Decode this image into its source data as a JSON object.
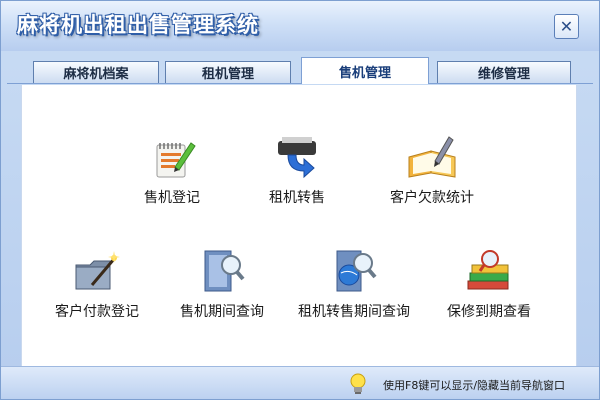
{
  "window": {
    "title": "麻将机出租出售管理系统",
    "close_glyph": "✕"
  },
  "tabs": [
    {
      "label": "麻将机档案",
      "active": false
    },
    {
      "label": "租机管理",
      "active": false
    },
    {
      "label": "售机管理",
      "active": true
    },
    {
      "label": "维修管理",
      "active": false
    }
  ],
  "items": [
    {
      "label": "售机登记",
      "icon": "notebook-pen-icon"
    },
    {
      "label": "租机转售",
      "icon": "printer-arrow-icon"
    },
    {
      "label": "客户欠款统计",
      "icon": "open-notebook-pencil-icon"
    },
    {
      "label": "客户付款登记",
      "icon": "folder-wand-icon"
    },
    {
      "label": "售机期间查询",
      "icon": "document-magnifier-icon"
    },
    {
      "label": "租机转售期间查询",
      "icon": "document-globe-magnifier-icon"
    },
    {
      "label": "保修到期查看",
      "icon": "books-magnifier-icon"
    }
  ],
  "status": {
    "text": "使用F8键可以显示/隐藏当前导航窗口",
    "icon": "lightbulb-icon"
  },
  "colors": {
    "title_outline": "#2f5ea8",
    "frame": "#b6cdee",
    "panel": "#ffffff"
  }
}
